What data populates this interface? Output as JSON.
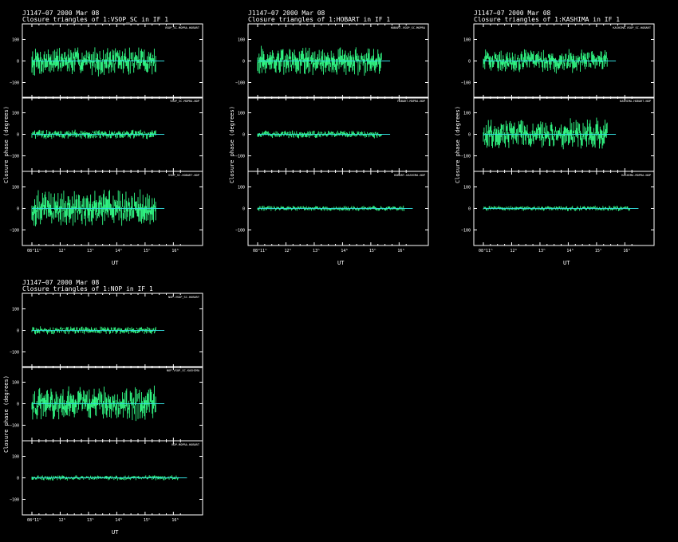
{
  "figures": [
    {
      "title_line1": "J1147−07  2000 Mar 08",
      "title_line2": "Closure triangles of 1:VSOP_SC in IF 1",
      "ylabel": "Closure phase (degrees)",
      "xlabel": "UT",
      "panels": [
        {
          "label": "VSOP_SC-MOPRA-HOBART"
        },
        {
          "label": "VSOP_SC-MOPRA-NOP"
        },
        {
          "label": "VSOP_SC-HOBART-NOP"
        }
      ]
    },
    {
      "title_line1": "J1147−07  2000 Mar 08",
      "title_line2": "Closure triangles of 1:HOBART in IF 1",
      "ylabel": "Closure phase (degrees)",
      "xlabel": "UT",
      "panels": [
        {
          "label": "HOBART-VSOP_SC-MOPRA"
        },
        {
          "label": "HOBART-MOPRA-NOP"
        },
        {
          "label": "HOBART-KASHIMA-NOP"
        }
      ]
    },
    {
      "title_line1": "J1147−07  2000 Mar 08",
      "title_line2": "Closure triangles of 1:KASHIMA in IF 1",
      "ylabel": "Closure phase (degrees)",
      "xlabel": "UT",
      "panels": [
        {
          "label": "KASHIMA-VSOP_SC-HOBART"
        },
        {
          "label": "KASHIMA-HOBART-NOP"
        },
        {
          "label": "KASHIMA-MOPRA-NOP"
        }
      ]
    },
    {
      "title_line1": "J1147−07  2000 Mar 08",
      "title_line2": "Closure triangles of 1:NOP in IF 1",
      "ylabel": "Closure phase (degrees)",
      "xlabel": "UT",
      "panels": [
        {
          "label": "NOP-VSOP_SC-HOBART"
        },
        {
          "label": "NOP-VSOP_SC-KASHIMA"
        },
        {
          "label": "NOP-MOPRA-HOBART"
        }
      ]
    }
  ],
  "chart_data": {
    "type": "scatter",
    "description_axis": {
      "y_ticks": [
        -100,
        0,
        100
      ],
      "ylim": [
        -180,
        180
      ],
      "x_ticks": [
        "08ᵈ11ʰ",
        "12ʰ",
        "13ʰ",
        "14ʰ",
        "15ʰ",
        "16ʰ"
      ],
      "xlim": [
        11,
        16.3
      ]
    },
    "colors": {
      "data": "#33ff88",
      "zero_line": "#33dddd",
      "frame": "#ffffff"
    },
    "panels": [
      [
        {
          "x_end": 15.4,
          "spread": 55
        },
        {
          "x_end": 15.4,
          "spread": 18
        },
        {
          "x_end": 15.4,
          "spread": 70
        }
      ],
      [
        {
          "x_end": 15.4,
          "spread": 55
        },
        {
          "x_end": 15.4,
          "spread": 15
        },
        {
          "x_end": 16.2,
          "spread": 10
        }
      ],
      [
        {
          "x_end": 15.4,
          "spread": 45
        },
        {
          "x_end": 15.4,
          "spread": 60
        },
        {
          "x_end": 16.2,
          "spread": 10
        }
      ],
      [
        {
          "x_end": 15.4,
          "spread": 15
        },
        {
          "x_end": 15.4,
          "spread": 65
        },
        {
          "x_end": 16.2,
          "spread": 10
        }
      ]
    ]
  }
}
